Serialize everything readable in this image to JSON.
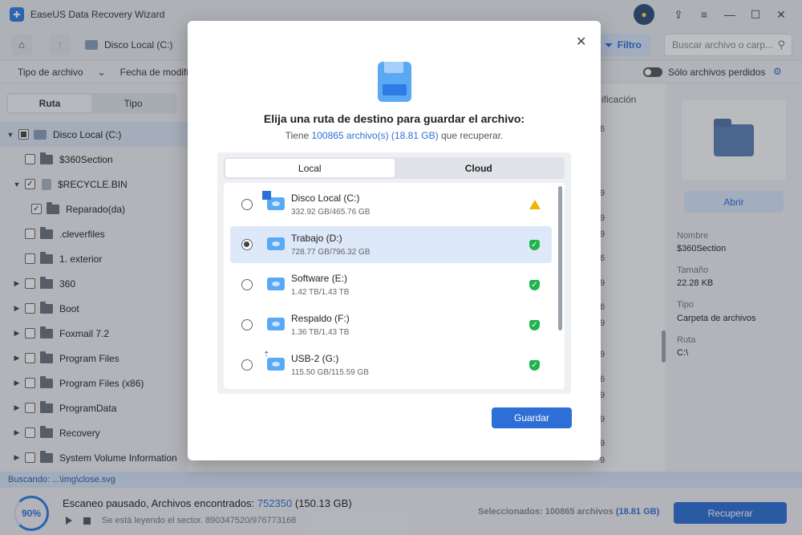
{
  "window": {
    "title": "EaseUS Data Recovery Wizard"
  },
  "toolbar": {
    "path": "Disco Local (C:)",
    "filter_label": "Filtro",
    "search_placeholder": "Buscar archivo o carp..."
  },
  "filters": {
    "file_type": "Tipo de archivo",
    "modified_date": "Fecha de modificaci",
    "lost_only": "Sólo archivos perdidos"
  },
  "left_panel": {
    "tabs": [
      "Ruta",
      "Tipo"
    ],
    "tree": [
      {
        "label": "Disco Local (C:)"
      },
      {
        "label": "$360Section"
      },
      {
        "label": "$RECYCLE.BIN"
      },
      {
        "label": "Reparado(da)"
      },
      {
        "label": ".cleverfiles"
      },
      {
        "label": "1. exterior"
      },
      {
        "label": "360"
      },
      {
        "label": "Boot"
      },
      {
        "label": "Foxmail 7.2"
      },
      {
        "label": "Program Files"
      },
      {
        "label": "Program Files (x86)"
      },
      {
        "label": "ProgramData"
      },
      {
        "label": "Recovery"
      },
      {
        "label": "System Volume Information"
      }
    ]
  },
  "middle": {
    "header_fragment": "ificación",
    "row_fragments": [
      "6",
      "9",
      "9",
      "9",
      "6",
      "9",
      "6",
      "9",
      "9",
      "6",
      "9",
      "9",
      "9",
      "9"
    ]
  },
  "right_panel": {
    "open_label": "Abrir",
    "name_label": "Nombre",
    "name_value": "$360Section",
    "size_label": "Tamaño",
    "size_value": "22.28 KB",
    "type_label": "Tipo",
    "type_value": "Carpeta de archivos",
    "route_label": "Ruta",
    "route_value": "C:\\"
  },
  "status": {
    "searching": "Buscando: ...\\img\\close.svg",
    "progress_label": "90%",
    "progress_percent": 90,
    "scan_text": "Escaneo pausado, Archivos encontrados:",
    "found_count": "752350",
    "found_size": "(150.13 GB)",
    "sector_text": "Se está leyendo el sector. 890347520/976773168",
    "selected_text": "Seleccionados: 100865 archivos",
    "selected_size": "(18.81 GB)",
    "recover_label": "Recuperar"
  },
  "dialog": {
    "title": "Elija una ruta de destino para guardar el archivo:",
    "subtitle_prefix": "Tiene",
    "subtitle_count": "100865 archivo(s) (18.81 GB)",
    "subtitle_suffix": "que recuperar.",
    "tabs": [
      "Local",
      "Cloud"
    ],
    "drives": [
      {
        "name": "Disco Local (C:)",
        "size": "332.92 GB/465.76 GB",
        "status": "warning",
        "selected": false
      },
      {
        "name": "Trabajo (D:)",
        "size": "728.77 GB/796.32 GB",
        "status": "ok",
        "selected": true
      },
      {
        "name": "Software (E:)",
        "size": "1.42 TB/1.43 TB",
        "status": "ok",
        "selected": false
      },
      {
        "name": "Respaldo (F:)",
        "size": "1.36 TB/1.43 TB",
        "status": "ok",
        "selected": false
      },
      {
        "name": "USB-2 (G:)",
        "size": "115.50 GB/115.59 GB",
        "status": "ok",
        "selected": false
      }
    ],
    "save_label": "Guardar"
  },
  "colors": {
    "accent": "#2d6fd6",
    "ok": "#21b34e",
    "warning": "#f0b400"
  }
}
